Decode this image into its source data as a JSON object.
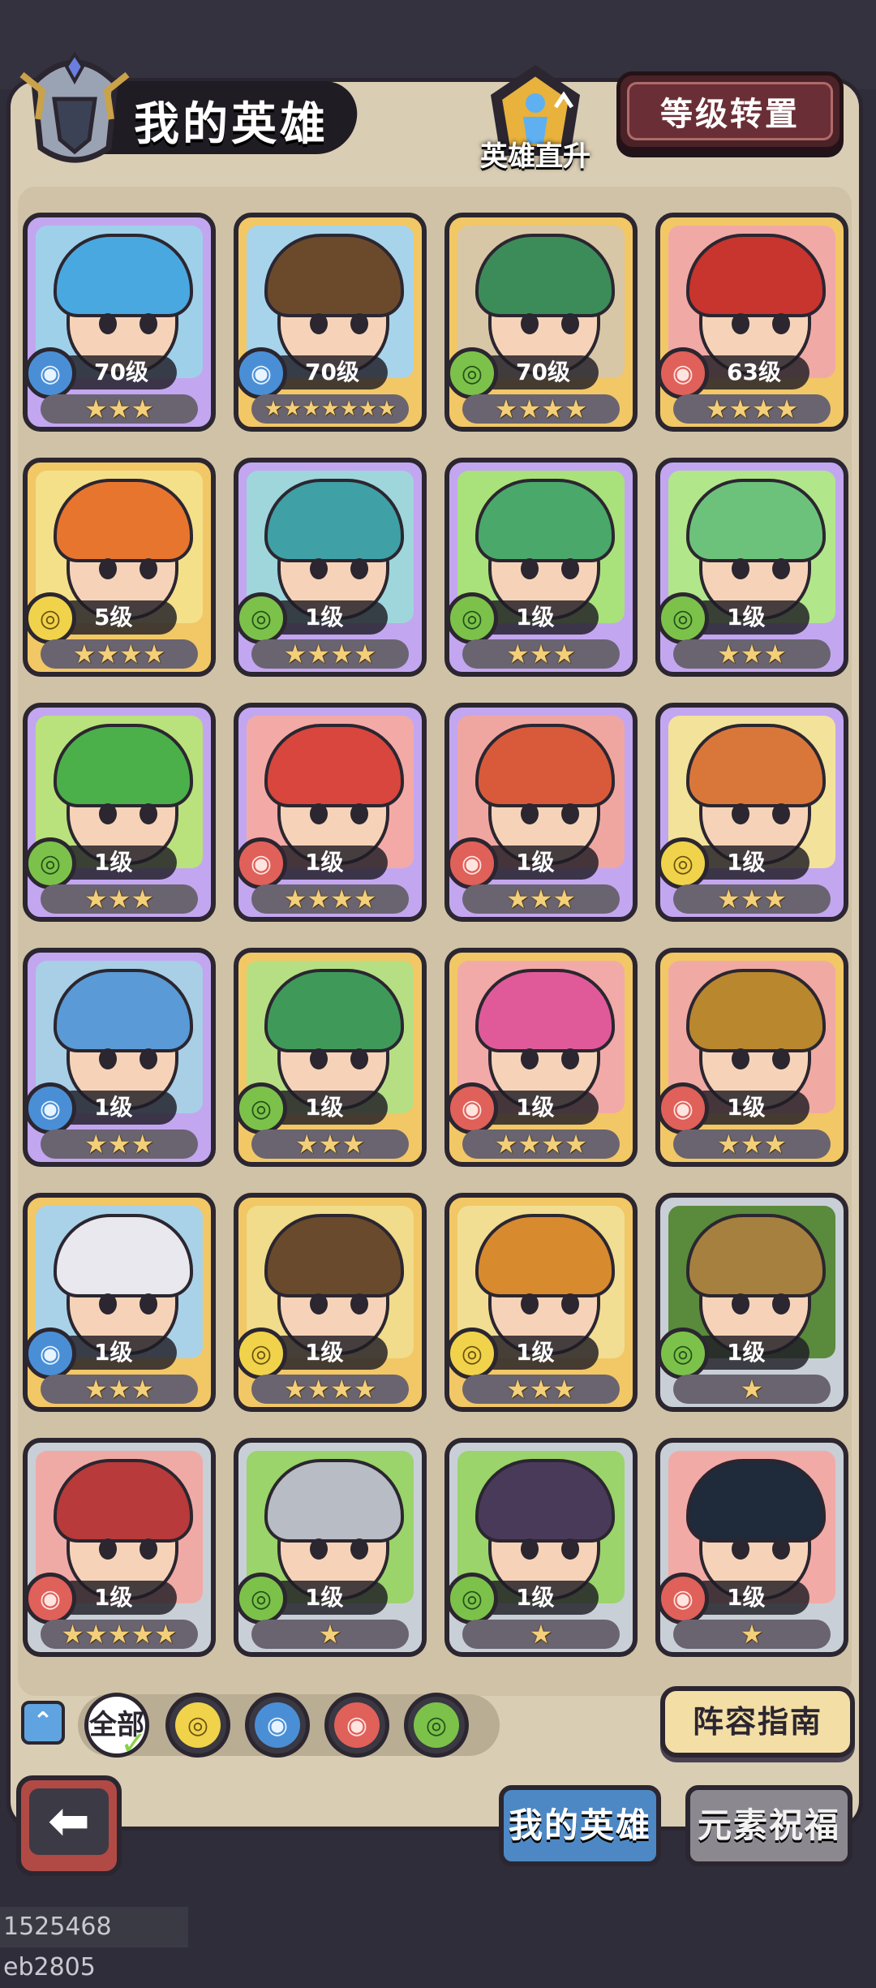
{
  "header": {
    "title": "我的英雄",
    "hero_rise_label": "英雄直升",
    "level_transfer_button": "等级转置"
  },
  "heroes": [
    {
      "level": "70级",
      "element": "water",
      "stars": 3,
      "rarity": "purple",
      "hair": "#4aa8e0",
      "bg": "#9fd0ea"
    },
    {
      "level": "70级",
      "element": "water",
      "stars": 7,
      "rarity": "gold",
      "hair": "#6b4a2c",
      "bg": "#a7d4ea"
    },
    {
      "level": "70级",
      "element": "wood",
      "stars": 4,
      "rarity": "gold",
      "hair": "#3c8c5a",
      "bg": "#d8c7a6"
    },
    {
      "level": "63级",
      "element": "fire",
      "stars": 4,
      "rarity": "gold",
      "hair": "#c8342e",
      "bg": "#f1a9a6"
    },
    {
      "level": "5级",
      "element": "earth",
      "stars": 4,
      "rarity": "gold",
      "hair": "#e8752e",
      "bg": "#f5e08a"
    },
    {
      "level": "1级",
      "element": "wood",
      "stars": 4,
      "rarity": "purple",
      "hair": "#3fa0a6",
      "bg": "#9ed6dc"
    },
    {
      "level": "1级",
      "element": "wood",
      "stars": 3,
      "rarity": "purple",
      "hair": "#4aa86a",
      "bg": "#a9e27a"
    },
    {
      "level": "1级",
      "element": "wood",
      "stars": 3,
      "rarity": "purple",
      "hair": "#6cc27a",
      "bg": "#b2e68a"
    },
    {
      "level": "1级",
      "element": "wood",
      "stars": 3,
      "rarity": "purple",
      "hair": "#4bb04a",
      "bg": "#b9e27c"
    },
    {
      "level": "1级",
      "element": "fire",
      "stars": 4,
      "rarity": "purple",
      "hair": "#d8463e",
      "bg": "#f3aaa6"
    },
    {
      "level": "1级",
      "element": "fire",
      "stars": 3,
      "rarity": "purple",
      "hair": "#d85a3a",
      "bg": "#f0a6a0"
    },
    {
      "level": "1级",
      "element": "earth",
      "stars": 3,
      "rarity": "purple",
      "hair": "#d9773a",
      "bg": "#f3e29a"
    },
    {
      "level": "1级",
      "element": "water",
      "stars": 3,
      "rarity": "purple",
      "hair": "#5a9ad6",
      "bg": "#a8cfe6"
    },
    {
      "level": "1级",
      "element": "wood",
      "stars": 3,
      "rarity": "gold",
      "hair": "#3f9a5a",
      "bg": "#b6df84"
    },
    {
      "level": "1级",
      "element": "fire",
      "stars": 4,
      "rarity": "gold",
      "hair": "#e05a9a",
      "bg": "#f1aaa8"
    },
    {
      "level": "1级",
      "element": "fire",
      "stars": 3,
      "rarity": "gold",
      "hair": "#b8872e",
      "bg": "#f0aaa3"
    },
    {
      "level": "1级",
      "element": "water",
      "stars": 3,
      "rarity": "gold",
      "hair": "#e8e8ee",
      "bg": "#a9d2e8"
    },
    {
      "level": "1级",
      "element": "earth",
      "stars": 4,
      "rarity": "gold",
      "hair": "#6a4a2c",
      "bg": "#f0dc8a"
    },
    {
      "level": "1级",
      "element": "earth",
      "stars": 3,
      "rarity": "gold",
      "hair": "#d88a2e",
      "bg": "#f1de92"
    },
    {
      "level": "1级",
      "element": "wood",
      "stars": 1,
      "rarity": "silver",
      "hair": "#a6803e",
      "bg": "#5a8a3c"
    },
    {
      "level": "1级",
      "element": "fire",
      "stars": 5,
      "rarity": "silver",
      "hair": "#b83a3a",
      "bg": "#f0aaa6"
    },
    {
      "level": "1级",
      "element": "wood",
      "stars": 1,
      "rarity": "silver",
      "hair": "#b8bcc4",
      "bg": "#9ad46a"
    },
    {
      "level": "1级",
      "element": "wood",
      "stars": 1,
      "rarity": "silver",
      "hair": "#4a3a5a",
      "bg": "#9ad46a"
    },
    {
      "level": "1级",
      "element": "fire",
      "stars": 1,
      "rarity": "silver",
      "hair": "#1f2a3a",
      "bg": "#f2aaa6"
    }
  ],
  "element_icons": {
    "water": "water-drop-icon",
    "wood": "leaf-swirl-icon",
    "fire": "flame-icon",
    "earth": "earth-swirl-icon"
  },
  "filters": {
    "all_label": "全部",
    "elements": [
      "earth",
      "water",
      "fire",
      "wood"
    ]
  },
  "lineup_guide_button": "阵容指南",
  "tabs": {
    "my_heroes": "我的英雄",
    "element_blessing": "元素祝福"
  },
  "watermark": "1525468 eb2805"
}
